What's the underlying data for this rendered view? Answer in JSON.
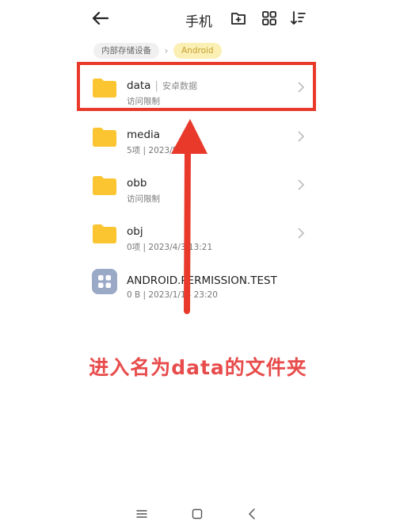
{
  "header": {
    "title": "手机",
    "icons": [
      "back-arrow-icon",
      "new-folder-icon",
      "grid-view-icon",
      "sort-icon"
    ]
  },
  "breadcrumb": {
    "items": [
      "内部存储设备",
      "Android"
    ]
  },
  "files": [
    {
      "name": "data",
      "tag": "安卓数据",
      "sub": "访问限制",
      "type": "folder"
    },
    {
      "name": "media",
      "sub": "5项 | 2023/5/  9",
      "type": "folder"
    },
    {
      "name": "obb",
      "sub": "访问限制",
      "type": "folder"
    },
    {
      "name": "obj",
      "sub": "0项 | 2023/4/3  13:21",
      "type": "folder"
    },
    {
      "name": "ANDROID.PERMISSION.TEST",
      "sub": "0 B | 2023/1/14  23:20",
      "type": "file"
    }
  ],
  "annotation": {
    "caption": "进入名为data的文件夹",
    "color": "#e8392b"
  },
  "colors": {
    "folder": "#fbc531",
    "highlight": "#e8392b",
    "caption": "#e84b4b"
  },
  "navbar": [
    "menu-icon",
    "home-icon",
    "back-icon"
  ]
}
